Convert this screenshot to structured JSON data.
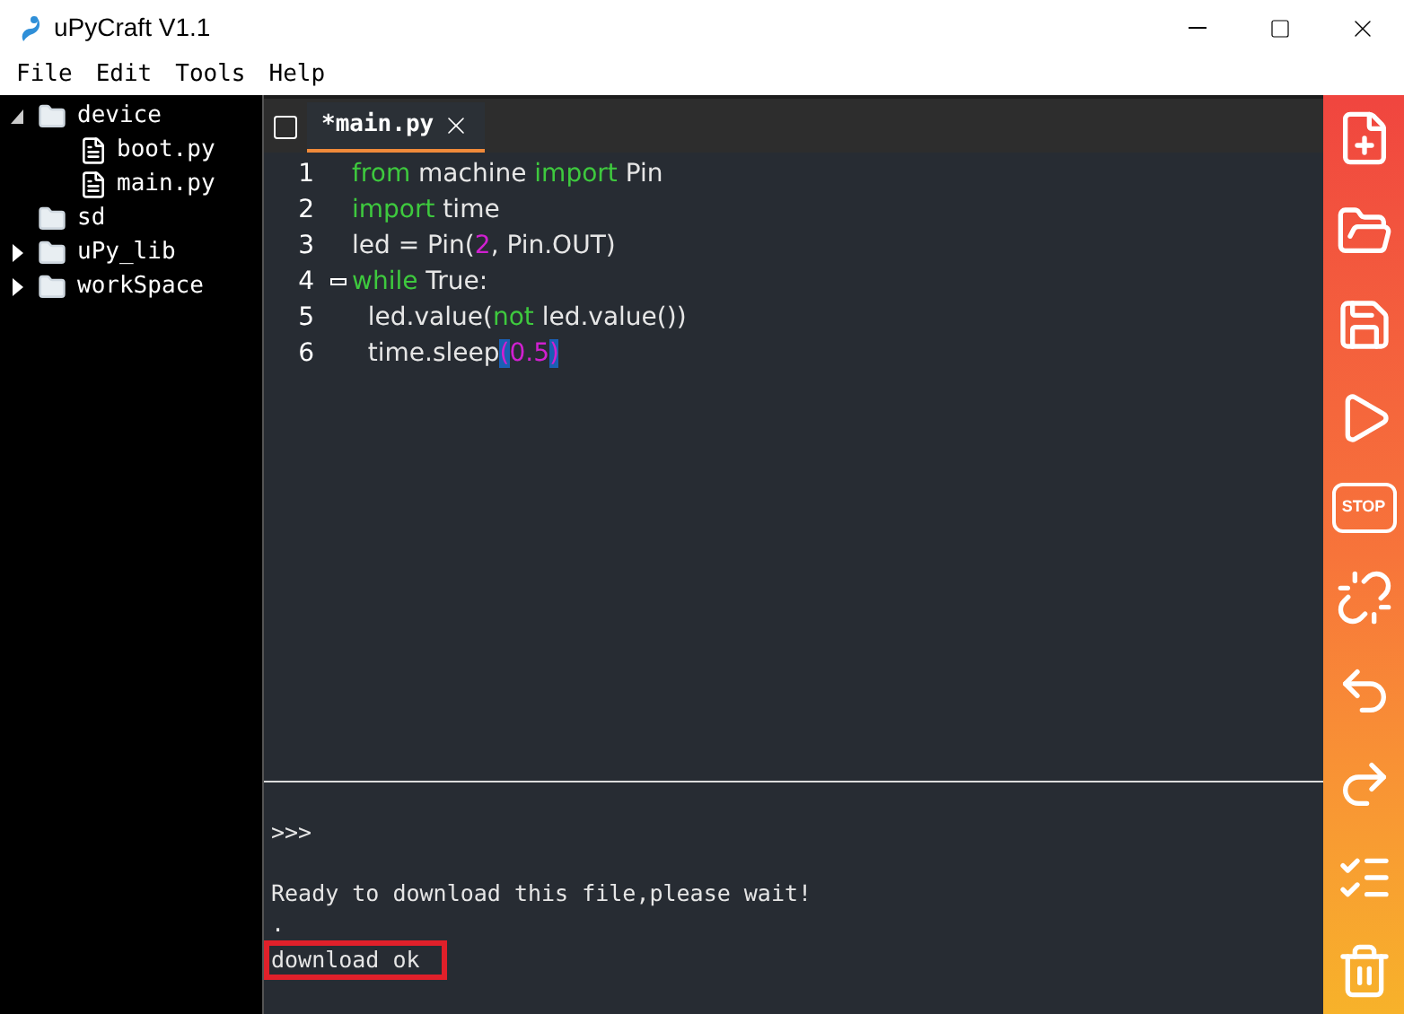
{
  "window": {
    "title": "uPyCraft V1.1"
  },
  "menu": [
    "File",
    "Edit",
    "Tools",
    "Help"
  ],
  "tree": [
    {
      "label": "device",
      "kind": "folder",
      "expanded": true,
      "children": [
        {
          "label": "boot.py",
          "kind": "file"
        },
        {
          "label": "main.py",
          "kind": "file"
        }
      ]
    },
    {
      "label": "sd",
      "kind": "folder"
    },
    {
      "label": "uPy_lib",
      "kind": "folder",
      "expanded": false
    },
    {
      "label": "workSpace",
      "kind": "folder",
      "expanded": false
    }
  ],
  "tabs": [
    {
      "label": "*main.py",
      "selected": true
    }
  ],
  "code": [
    {
      "number": "1",
      "fold": false,
      "tokens": [
        {
          "kind": "keyword",
          "text": "from"
        },
        {
          "kind": "plain",
          "text": " machine "
        },
        {
          "kind": "keyword",
          "text": "import"
        },
        {
          "kind": "plain",
          "text": " Pin"
        }
      ]
    },
    {
      "number": "2",
      "fold": false,
      "tokens": [
        {
          "kind": "keyword",
          "text": "import"
        },
        {
          "kind": "plain",
          "text": " time"
        }
      ]
    },
    {
      "number": "3",
      "fold": false,
      "tokens": [
        {
          "kind": "plain",
          "text": "led = Pin("
        },
        {
          "kind": "number",
          "text": "2"
        },
        {
          "kind": "plain",
          "text": ", Pin.OUT)"
        }
      ]
    },
    {
      "number": "4",
      "fold": true,
      "tokens": [
        {
          "kind": "keyword",
          "text": "while"
        },
        {
          "kind": "plain",
          "text": " True:"
        }
      ]
    },
    {
      "number": "5",
      "fold": false,
      "tokens": [
        {
          "kind": "plain",
          "text": "  led.value("
        },
        {
          "kind": "keyword",
          "text": "not"
        },
        {
          "kind": "plain",
          "text": " led.value())"
        }
      ]
    },
    {
      "number": "6",
      "fold": false,
      "tokens": [
        {
          "kind": "plain",
          "text": "  time.sleep"
        },
        {
          "kind": "match",
          "text": "("
        },
        {
          "kind": "number",
          "text": "0.5"
        },
        {
          "kind": "match",
          "text": ")"
        }
      ]
    }
  ],
  "terminal": [
    {
      "text": ">>>",
      "highlighted": false
    },
    {
      "text": "Ready to download this file,please wait!",
      "highlighted": false
    },
    {
      "text": ".",
      "highlighted": false
    },
    {
      "text": "download ok",
      "highlighted": true
    }
  ],
  "toolbar": [
    {
      "kind": "new"
    },
    {
      "kind": "open"
    },
    {
      "kind": "save"
    },
    {
      "kind": "run"
    },
    {
      "kind": "stop",
      "label": "STOP"
    },
    {
      "kind": "connect"
    },
    {
      "kind": "undo"
    },
    {
      "kind": "redo"
    },
    {
      "kind": "check"
    },
    {
      "kind": "clear"
    }
  ]
}
